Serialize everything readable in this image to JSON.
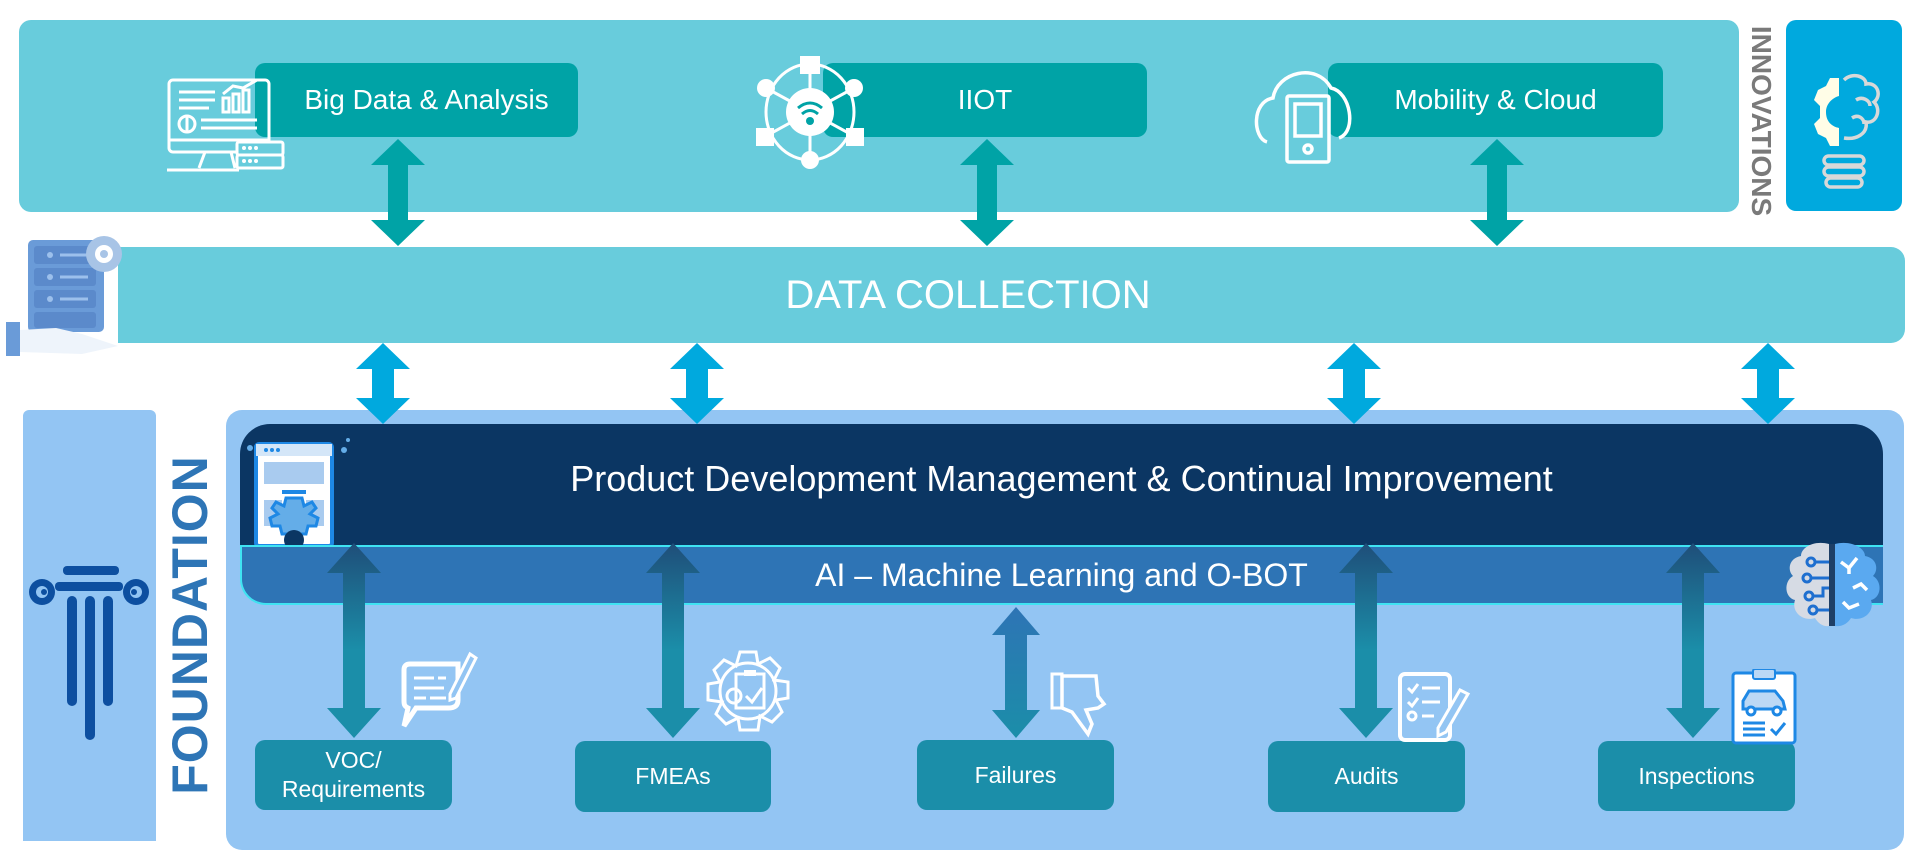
{
  "innovations": {
    "label": "INNOVATIONS",
    "items": [
      {
        "label": "Big Data & Analysis",
        "icon": "analytics-monitor-icon"
      },
      {
        "label": "IIOT",
        "icon": "iot-network-icon"
      },
      {
        "label": "Mobility & Cloud",
        "icon": "cloud-mobile-icon"
      }
    ],
    "badge_icon": "lightbulb-gear-brain-icon"
  },
  "data_collection": {
    "label": "DATA COLLECTION",
    "icon": "server-hand-icon"
  },
  "foundation": {
    "label": "FOUNDATION",
    "icon": "pillar-icon",
    "main_title": "Product Development Management & Continual Improvement",
    "main_icon": "webpage-gear-icon",
    "ai_label": "AI – Machine Learning and O-BOT",
    "ai_icon": "ai-brain-icon",
    "items": [
      {
        "label_line1": "VOC/",
        "label_line2": "Requirements",
        "icon": "chat-pencil-icon"
      },
      {
        "label_line1": "FMEAs",
        "label_line2": "",
        "icon": "gear-clipboard-icon"
      },
      {
        "label_line1": "Failures",
        "label_line2": "",
        "icon": "thumbs-down-icon"
      },
      {
        "label_line1": "Audits",
        "label_line2": "",
        "icon": "checklist-pencil-icon"
      },
      {
        "label_line1": "Inspections",
        "label_line2": "",
        "icon": "car-inspection-clipboard-icon"
      }
    ]
  },
  "colors": {
    "top_band": "#68CCDC",
    "top_box": "#00A3A6",
    "innovation_badge": "#00A9DE",
    "data_arrow": "#00A9DE",
    "foundation_panel": "#93C5F3",
    "main_box": "#0B3663",
    "ai_bar": "#2E74B5",
    "foundation_text": "#2E75B6",
    "bottom_box": "#1B8EA9"
  }
}
